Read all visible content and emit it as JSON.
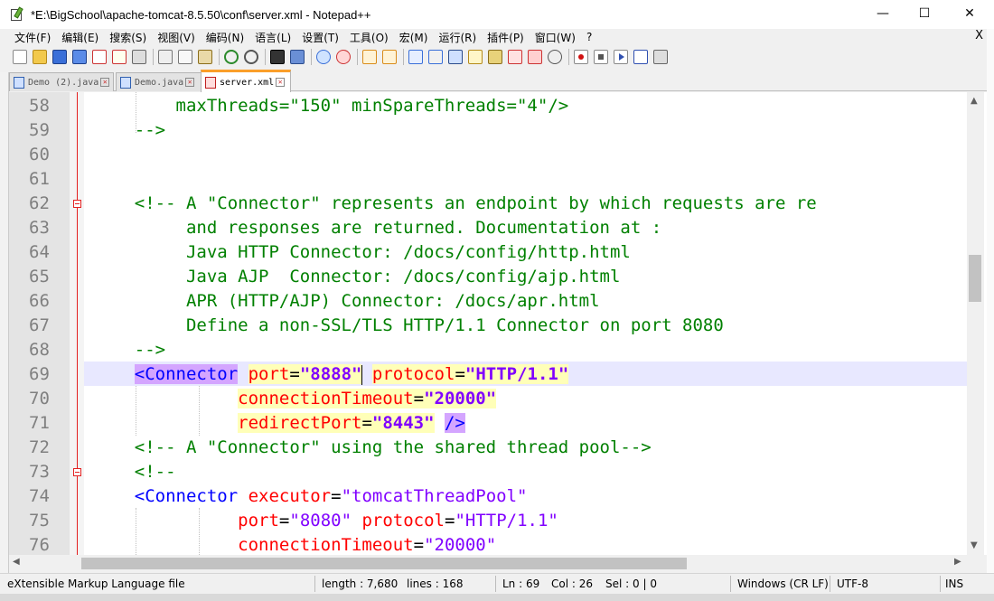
{
  "window": {
    "title": "*E:\\BigSchool\\apache-tomcat-8.5.50\\conf\\server.xml - Notepad++",
    "minimize": "—",
    "maximize": "☐",
    "close": "✕"
  },
  "menu": {
    "items": [
      "文件(F)",
      "编辑(E)",
      "搜索(S)",
      "视图(V)",
      "编码(N)",
      "语言(L)",
      "设置(T)",
      "工具(O)",
      "宏(M)",
      "运行(R)",
      "插件(P)",
      "窗口(W)",
      "?"
    ],
    "close": "X"
  },
  "toolbar": {
    "icons": [
      "new-file-icon",
      "open-file-icon",
      "save-icon",
      "save-all-icon",
      "close-icon",
      "close-all-icon",
      "print-icon",
      "cut-icon",
      "copy-icon",
      "paste-icon",
      "undo-icon",
      "redo-icon",
      "find-icon",
      "replace-icon",
      "zoom-in-icon",
      "zoom-out-icon",
      "sync-v-icon",
      "sync-h-icon",
      "wrap-icon",
      "all-chars-icon",
      "indent-guide-icon",
      "udl-icon",
      "doc-map-icon",
      "function-list-icon",
      "folder-workspace-icon",
      "monitor-icon",
      "record-macro-icon",
      "stop-macro-icon",
      "play-macro-icon",
      "run-macro-multiple-icon",
      "save-macro-icon"
    ]
  },
  "tabs": [
    {
      "label": "Demo (2).java",
      "active": false
    },
    {
      "label": "Demo.java",
      "active": false
    },
    {
      "label": "server.xml",
      "active": true
    }
  ],
  "editor": {
    "current_line": 69,
    "lines": [
      {
        "n": "58",
        "fold": false,
        "text": "        maxThreads=\"150\" minSpareThreads=\"4\"/>"
      },
      {
        "n": "59",
        "fold": false,
        "text": "    -->"
      },
      {
        "n": "60",
        "fold": false,
        "text": ""
      },
      {
        "n": "61",
        "fold": false,
        "text": ""
      },
      {
        "n": "62",
        "fold": true,
        "text": "    <!-- A \"Connector\" represents an endpoint by which requests are re"
      },
      {
        "n": "63",
        "fold": false,
        "text": "         and responses are returned. Documentation at :"
      },
      {
        "n": "64",
        "fold": false,
        "text": "         Java HTTP Connector: /docs/config/http.html"
      },
      {
        "n": "65",
        "fold": false,
        "text": "         Java AJP  Connector: /docs/config/ajp.html"
      },
      {
        "n": "66",
        "fold": false,
        "text": "         APR (HTTP/AJP) Connector: /docs/apr.html"
      },
      {
        "n": "67",
        "fold": false,
        "text": "         Define a non-SSL/TLS HTTP/1.1 Connector on port 8080"
      },
      {
        "n": "68",
        "fold": false,
        "text": "    -->"
      },
      {
        "n": "69",
        "fold": false,
        "tag": "<Connector",
        "attr1": "port",
        "val1": "\"8888\"",
        "attr2": "protocol",
        "val2": "\"HTTP/1.1\""
      },
      {
        "n": "70",
        "fold": false,
        "attr1": "connectionTimeout",
        "val1": "\"20000\""
      },
      {
        "n": "71",
        "fold": false,
        "attr1": "redirectPort",
        "val1": "\"8443\"",
        "close": "/>"
      },
      {
        "n": "72",
        "fold": false,
        "text": "    <!-- A \"Connector\" using the shared thread pool-->"
      },
      {
        "n": "73",
        "fold": true,
        "text": "    <!--"
      },
      {
        "n": "74",
        "fold": false,
        "tag": "<Connector",
        "attr1": "executor",
        "val1": "\"tomcatThreadPool\""
      },
      {
        "n": "75",
        "fold": false,
        "attr1": "port",
        "val1": "\"8080\"",
        "attr2": "protocol",
        "val2": "\"HTTP/1.1\""
      },
      {
        "n": "76",
        "fold": false,
        "attr1": "connectionTimeout",
        "val1": "\"20000\""
      }
    ]
  },
  "status": {
    "file_type": "eXtensible Markup Language file",
    "length": "length : 7,680",
    "lines": "lines : 168",
    "ln": "Ln : 69",
    "col": "Col : 26",
    "sel": "Sel : 0 | 0",
    "eol": "Windows (CR LF)",
    "encoding": "UTF-8",
    "mode": "INS"
  },
  "colors": {
    "comment": "#008000",
    "tag": "#0000ff",
    "attribute": "#ff0000",
    "value": "#8000ff",
    "tag_match": "#d4a5ff",
    "attr_highlight": "#ffffb8",
    "current_line": "#e8e8ff",
    "tab_active_accent": "#fa9f2a"
  }
}
